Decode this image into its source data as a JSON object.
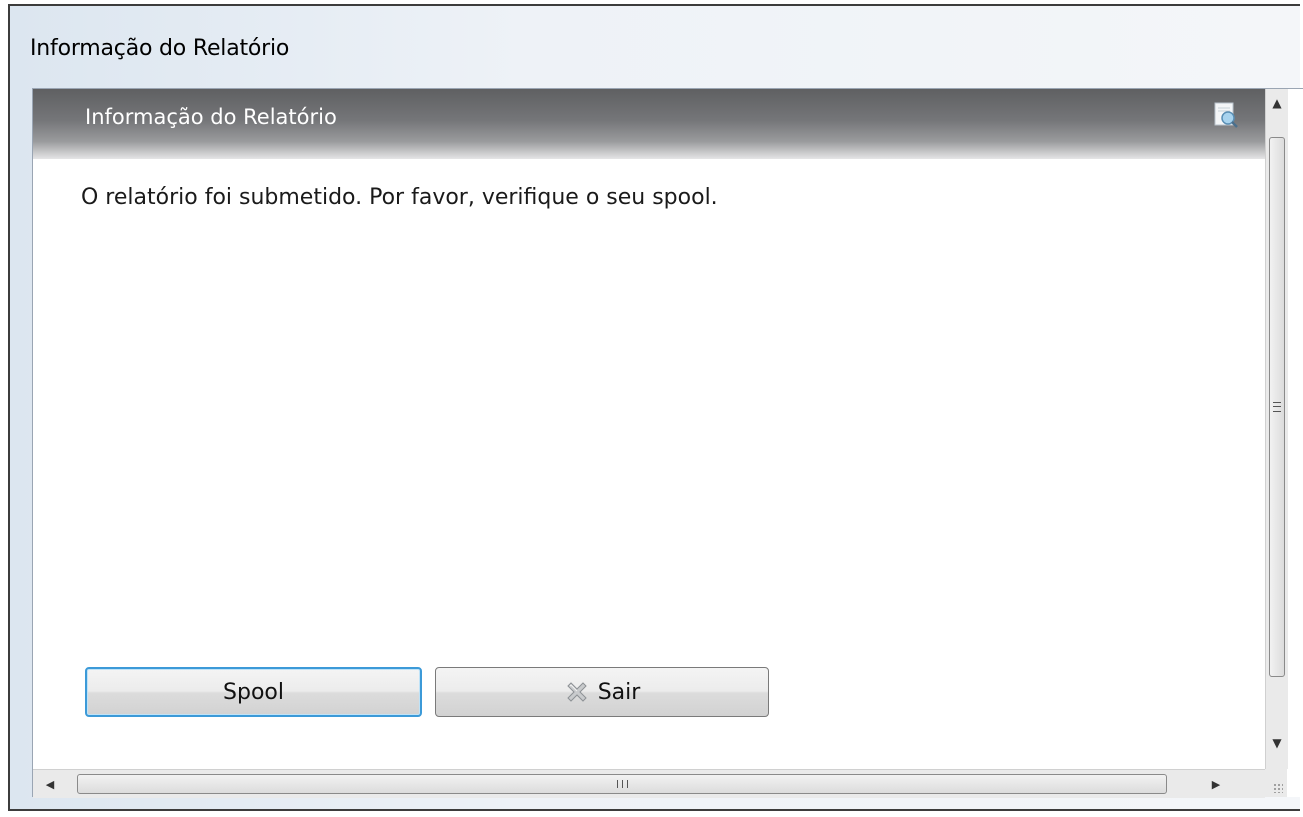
{
  "window": {
    "title": "Informação do Relatório"
  },
  "panel": {
    "title": "Informação do Relatório",
    "header_icon": "search-document-icon",
    "message": "O relatório foi submetido. Por favor, verifique o seu spool."
  },
  "buttons": {
    "spool_label": "Spool",
    "sair_label": "Sair",
    "sair_icon": "close-icon"
  },
  "scrollbars": {
    "up_arrow": "▲",
    "down_arrow": "▼",
    "left_arrow": "◀",
    "right_arrow": "▶"
  },
  "colors": {
    "header_gradient_top": "#5f6062",
    "focus_border": "#3c9ad8"
  }
}
